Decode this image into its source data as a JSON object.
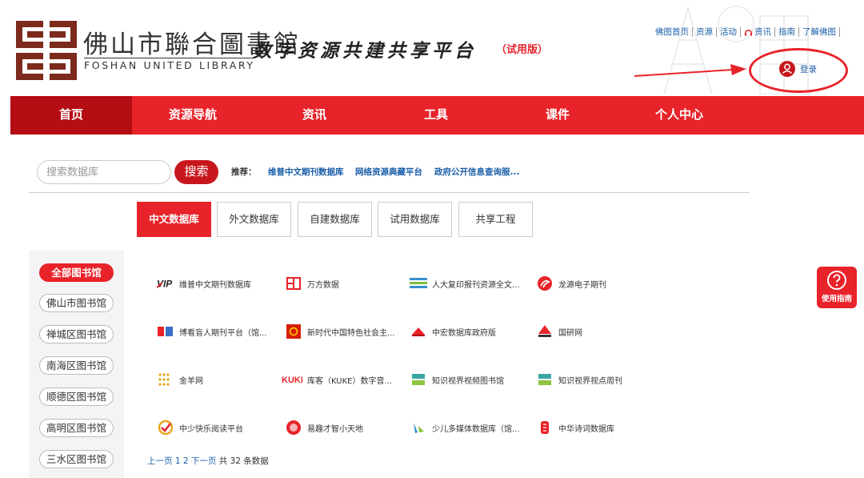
{
  "header": {
    "library_name_cn": "佛山市聯合圖書館",
    "library_name_en": "FOSHAN UNITED LIBRARY",
    "platform_title": "数字资源共建共享平台",
    "trial_badge": "（试用版）",
    "top_links": [
      "佛图首页",
      "资源",
      "活动",
      "资讯",
      "指南",
      "了解佛图"
    ],
    "login_label": "登录"
  },
  "nav": {
    "items": [
      "首页",
      "资源导航",
      "资讯",
      "工具",
      "课件",
      "个人中心"
    ],
    "active_index": 0
  },
  "search": {
    "placeholder": "搜索数据库",
    "button_label": "搜索",
    "recommend_label": "推荐：",
    "recommend_links": [
      "维普中文期刊数据库",
      "网络资源典藏平台",
      "政府公开信息查询服..."
    ]
  },
  "tabs": {
    "items": [
      "中文数据库",
      "外文数据库",
      "自建数据库",
      "试用数据库",
      "共享工程"
    ],
    "active_index": 0
  },
  "libraries": {
    "items": [
      "全部图书馆",
      "佛山市图书馆",
      "禅城区图书馆",
      "南海区图书馆",
      "顺德区图书馆",
      "高明区图书馆",
      "三水区图书馆"
    ],
    "active_index": 0
  },
  "databases": [
    {
      "name": "维普中文期刊数据库",
      "icon": "vip-logo-icon"
    },
    {
      "name": "万方数据",
      "icon": "wanfang-logo-icon"
    },
    {
      "name": "人大复印报刊资源全文...",
      "icon": "renda-logo-icon"
    },
    {
      "name": "龙源电子期刊",
      "icon": "longyuan-logo-icon"
    },
    {
      "name": "博看盲人期刊平台（馆...",
      "icon": "bookan-logo-icon"
    },
    {
      "name": "新时代中国特色社会主...",
      "icon": "party-emblem-icon"
    },
    {
      "name": "中宏数据库政府版",
      "icon": "zhonghong-logo-icon"
    },
    {
      "name": "国研网",
      "icon": "drcnet-logo-icon"
    },
    {
      "name": "金羊网",
      "icon": "jinyang-logo-icon"
    },
    {
      "name": "库客（KUKE）数字音...",
      "icon": "kuke-logo-icon"
    },
    {
      "name": "知识视界视频图书馆",
      "icon": "zhishi-logo-icon"
    },
    {
      "name": "知识视界视点周刊",
      "icon": "zhishi-weekly-logo-icon"
    },
    {
      "name": "中少快乐阅读平台",
      "icon": "zhongshao-logo-icon"
    },
    {
      "name": "易趣才智小天地",
      "icon": "yiqu-logo-icon"
    },
    {
      "name": "少儿多媒体数据库（馆...",
      "icon": "children-media-logo-icon"
    },
    {
      "name": "中华诗词数据库",
      "icon": "poetry-logo-icon"
    }
  ],
  "pagination": {
    "prev": "上一页",
    "page1": "1",
    "page2": "2",
    "next": "下一页",
    "total": "共 32 条数据"
  },
  "guide_label": "使用指南",
  "colors": {
    "brand_red": "#e8232a",
    "dark_red": "#b40d14",
    "link_blue": "#1a5ea8",
    "logo_brown": "#7b2a1c"
  }
}
